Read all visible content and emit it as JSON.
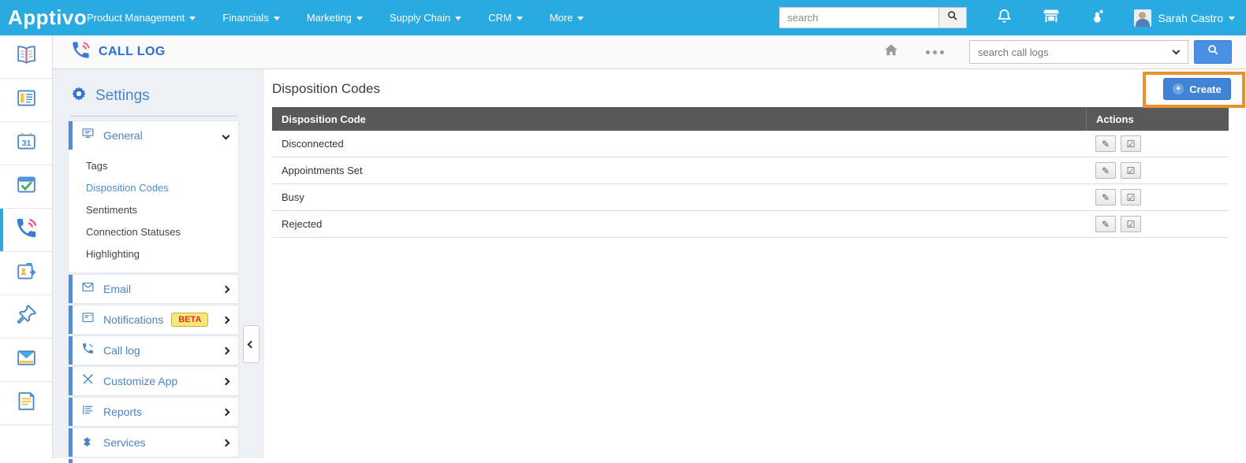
{
  "navbar": {
    "brand": "Apptivo",
    "menu": [
      "Product Management",
      "Financials",
      "Marketing",
      "Supply Chain",
      "CRM",
      "More"
    ],
    "search_placeholder": "search",
    "user_name": "Sarah Castro"
  },
  "appbar": {
    "title": "CALL LOG",
    "search_placeholder": "search call logs"
  },
  "settings": {
    "title": "Settings",
    "general": {
      "label": "General",
      "items": [
        "Tags",
        "Disposition Codes",
        "Sentiments",
        "Connection Statuses",
        "Highlighting"
      ],
      "active_item": "Disposition Codes"
    },
    "sections": [
      {
        "label": "Email"
      },
      {
        "label": "Notifications",
        "badge": "BETA"
      },
      {
        "label": "Call log"
      },
      {
        "label": "Customize App"
      },
      {
        "label": "Reports"
      },
      {
        "label": "Services"
      }
    ]
  },
  "main": {
    "title": "Disposition Codes",
    "create_label": "Create",
    "table": {
      "columns": [
        "Disposition Code",
        "Actions"
      ],
      "rows": [
        "Disconnected",
        "Appointments Set",
        "Busy",
        "Rejected"
      ]
    }
  },
  "icons": {
    "plus": "+",
    "edit": "✎",
    "verify": "☑",
    "calendar_day": "31"
  },
  "colors": {
    "brand_blue": "#29abe2",
    "link_blue": "#4a86c8",
    "create_blue": "#4183d7",
    "highlight_orange": "#e8912d",
    "table_header_gray": "#595959",
    "beta_bg": "#f7e878",
    "beta_text": "#e03131"
  }
}
